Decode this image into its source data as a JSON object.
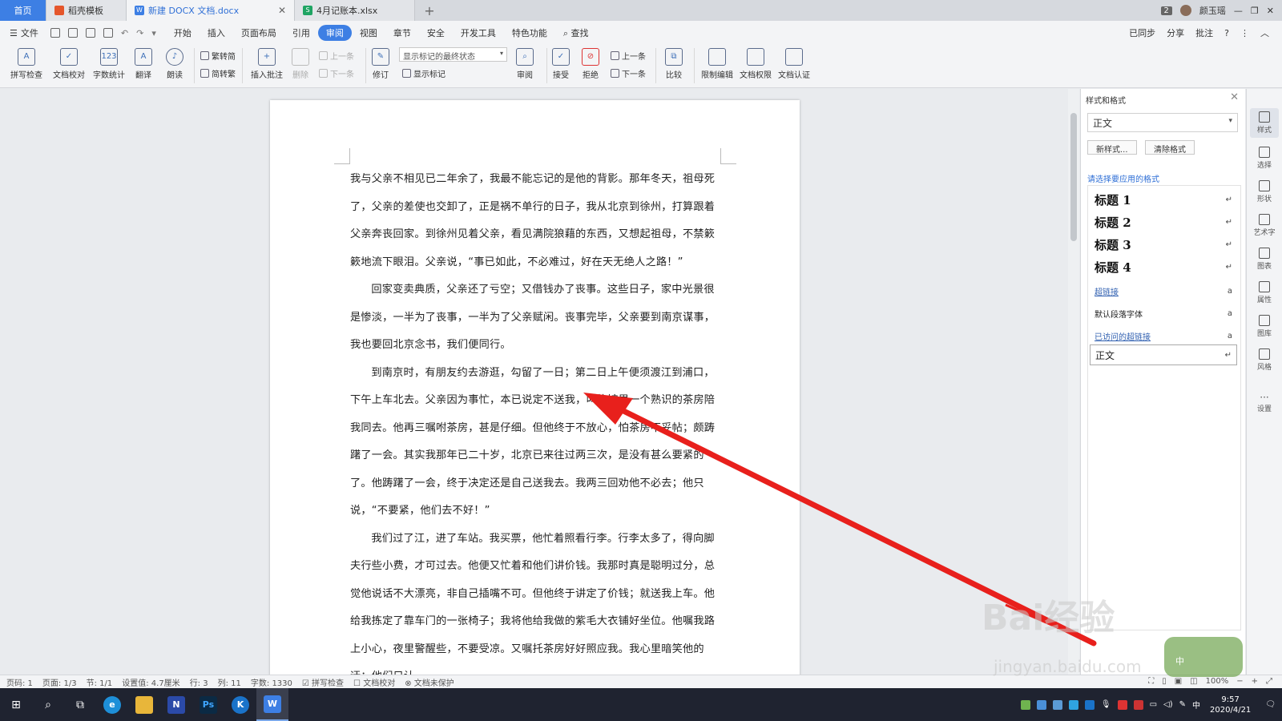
{
  "tabs": [
    {
      "label": "首页"
    },
    {
      "label": "稻壳模板"
    },
    {
      "label": "新建 DOCX 文档.docx"
    },
    {
      "label": "4月记账本.xlsx"
    }
  ],
  "window": {
    "badge": "2",
    "user": "颜玉瑶"
  },
  "menu": {
    "file": "文件",
    "items": [
      "开始",
      "插入",
      "页面布局",
      "引用",
      "审阅",
      "视图",
      "章节",
      "安全",
      "开发工具",
      "特色功能"
    ],
    "active": "审阅",
    "search": "查找",
    "right": [
      "已同步",
      "分享",
      "批注"
    ]
  },
  "ribbon": {
    "big": [
      "拼写检查",
      "文档校对",
      "字数统计",
      "翻译",
      "朗读",
      "插入批注",
      "修订",
      "审阅",
      "接受",
      "拒绝",
      "比较",
      "限制编辑",
      "文档权限",
      "文档认证"
    ],
    "small": {
      "to_trad": "繁转简",
      "to_simp": "简转繁",
      "delete": "删除",
      "prev_comment": "上一条",
      "next_comment": "下一条",
      "markup_select": "显示标记的最终状态",
      "show_markup": "显示标记",
      "prev": "上一条",
      "next": "下一条"
    }
  },
  "document": {
    "paragraphs": [
      {
        "indent": false,
        "text": "我与父亲不相见已二年余了，我最不能忘记的是他的背影。那年冬天，祖母死了，父亲的差使也交卸了，正是祸不单行的日子，我从北京到徐州，打算跟着父亲奔丧回家。到徐州见着父亲，看见满院狼藉的东西，又想起祖母，不禁簌簌地流下眼泪。父亲说，“事已如此，不必难过，好在天无绝人之路！”"
      },
      {
        "indent": true,
        "text": "回家变卖典质，父亲还了亏空；又借钱办了丧事。这些日子，家中光景很是惨淡，一半为了丧事，一半为了父亲赋闲。丧事完毕，父亲要到南京谋事，我也要回北京念书，我们便同行。"
      },
      {
        "indent": true,
        "text": "到南京时，有朋友约去游逛，勾留了一日；第二日上午便须渡江到浦口，下午上车北去。父亲因为事忙，本已说定不送我，叫旅馆里一个熟识的茶房陪我同去。他再三嘱咐茶房，甚是仔细。但他终于不放心，怕茶房不妥帖；颇踌躇了一会。其实我那年已二十岁，北京已来往过两三次，是没有甚么要紧的了。他踌躇了一会，终于决定还是自己送我去。我两三回劝他不必去；他只说，“不要紧，他们去不好！”"
      },
      {
        "indent": true,
        "text": "我们过了江，进了车站。我买票，他忙着照看行李。行李太多了，得向脚夫行些小费，才可过去。他便又忙着和他们讲价钱。我那时真是聪明过分，总觉他说话不大漂亮，非自己插嘴不可。但他终于讲定了价钱；就送我上车。他给我拣定了靠车门的一张椅子；我将他给我做的紫毛大衣铺好坐位。他嘱我路上小心，夜里警醒些，不要受凉。又嘱托茶房好好照应我。我心里暗笑他的迂；他们只认"
      }
    ]
  },
  "pane": {
    "title": "样式和格式",
    "current": "正文",
    "new_style": "新样式...",
    "clear": "清除格式",
    "prompt": "请选择要应用的格式",
    "styles": [
      "标题 1",
      "标题 2",
      "标题 3",
      "标题 4",
      "超链接",
      "默认段落字体",
      "已访问的超链接",
      "正文"
    ]
  },
  "right_sidebar": [
    "样式",
    "选择",
    "形状",
    "艺术字",
    "图表",
    "属性",
    "图库",
    "风格",
    "设置"
  ],
  "status": {
    "page": "页码: 1",
    "pages": "页面: 1/3",
    "section": "节: 1/1",
    "setting": "设置值: 4.7厘米",
    "row": "行: 3",
    "col": "列: 11",
    "words": "字数: 1330",
    "spell": "拼写检查",
    "proof": "文档校对",
    "protect": "文档未保护",
    "zoom": "100%"
  },
  "taskbar": {
    "time": "9:57",
    "date": "2020/4/21",
    "ime": "中"
  },
  "watermark": {
    "brand": "Bai经验",
    "url": "jingyan.baidu.com",
    "ime_label": "中"
  },
  "colors": {
    "accent": "#3d7fe4",
    "arrow": "#e8201c"
  }
}
